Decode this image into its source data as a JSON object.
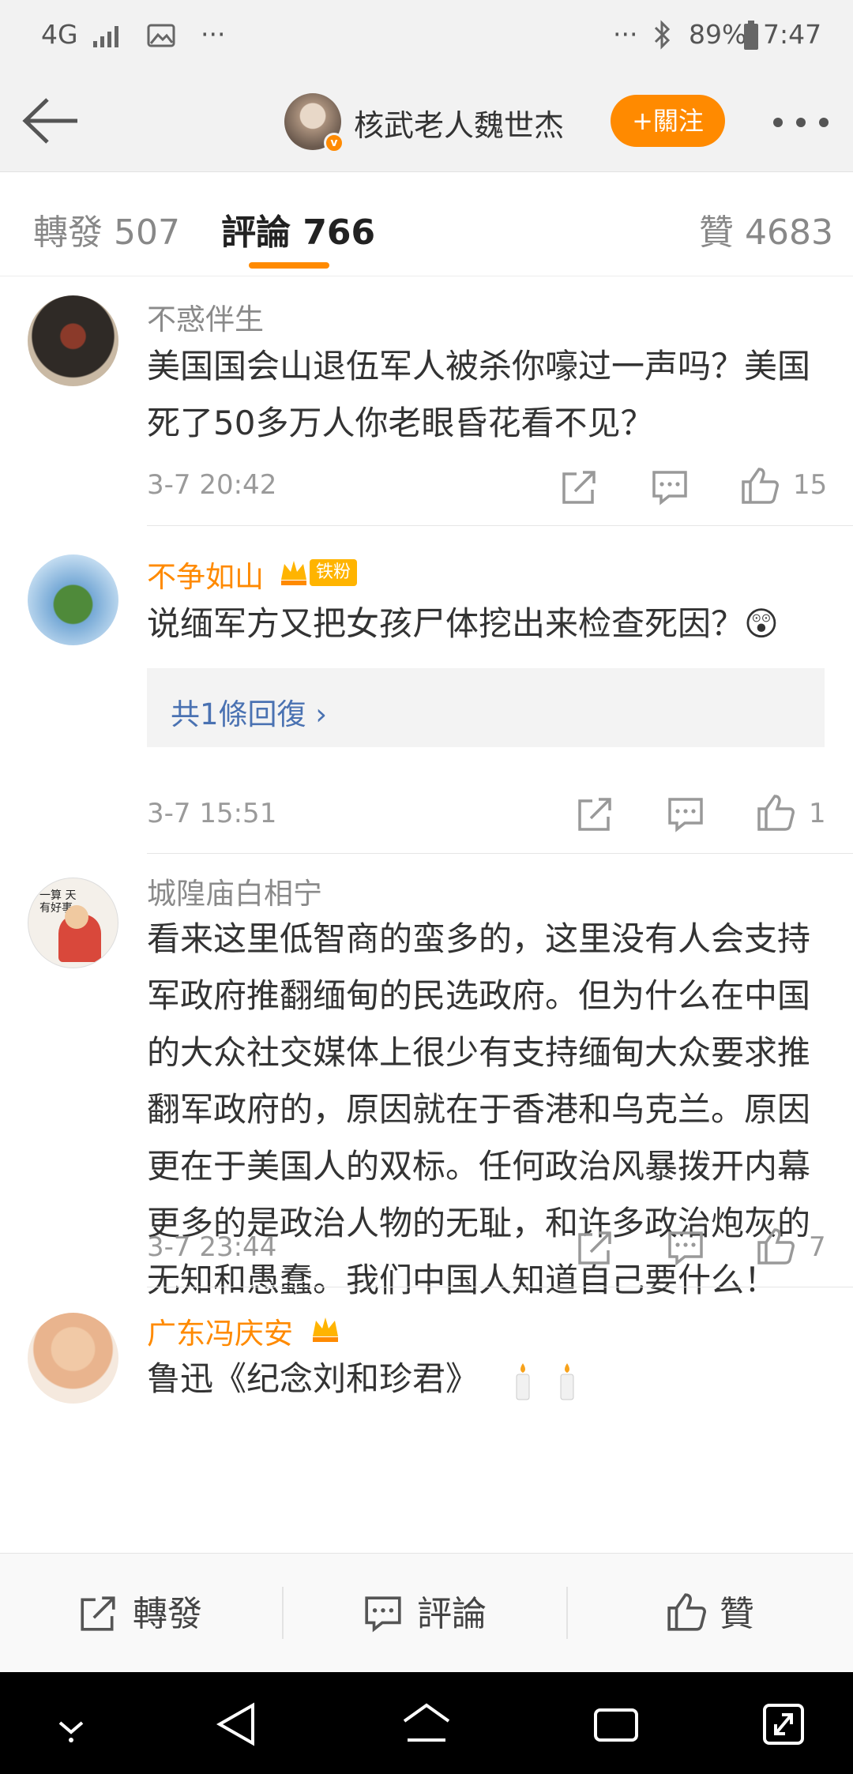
{
  "status_bar": {
    "network": "4G",
    "battery": "89%",
    "time": "7:47"
  },
  "header": {
    "name": "核武老人魏世杰",
    "verified": "v",
    "follow_label": "+關注"
  },
  "tabs": {
    "repost": "轉發 507",
    "comments": "評論 766",
    "likes": "贊 4683"
  },
  "comments": [
    {
      "username": "不惑伴生",
      "text": "美国国会山退伍军人被杀你嚎过一声吗？美国死了50多万人你老眼昏花看不见？",
      "time": "3-7 20:42",
      "likes": "15"
    },
    {
      "username": "不争如山",
      "badge": "铁粉",
      "text": "说缅军方又把女孩尸体挖出来检查死因？😲",
      "reply_label": "共1條回復 ›",
      "time": "3-7 15:51",
      "likes": "1"
    },
    {
      "username": "城隍庙白相宁",
      "avatar_text": "一算 天有好事",
      "text": "看来这里低智商的蛮多的，这里没有人会支持军政府推翻缅甸的民选政府。但为什么在中国的大众社交媒体上很少有支持缅甸大众要求推翻军政府的，原因就在于香港和乌克兰。原因更在于美国人的双标。任何政治风暴拨开内幕更多的是政治人物的无耻，和许多政治炮灰的无知和愚蠢。我们中国人知道自己要什么！",
      "time": "3-7 23:44",
      "likes": "7"
    },
    {
      "username": "广东冯庆安",
      "text": "鲁迅《纪念刘和珍君》"
    }
  ],
  "bottom_bar": {
    "repost": "轉發",
    "comment": "評論",
    "like": "贊"
  },
  "colors": {
    "accent": "#ff8a00",
    "link": "#4a72b2"
  }
}
